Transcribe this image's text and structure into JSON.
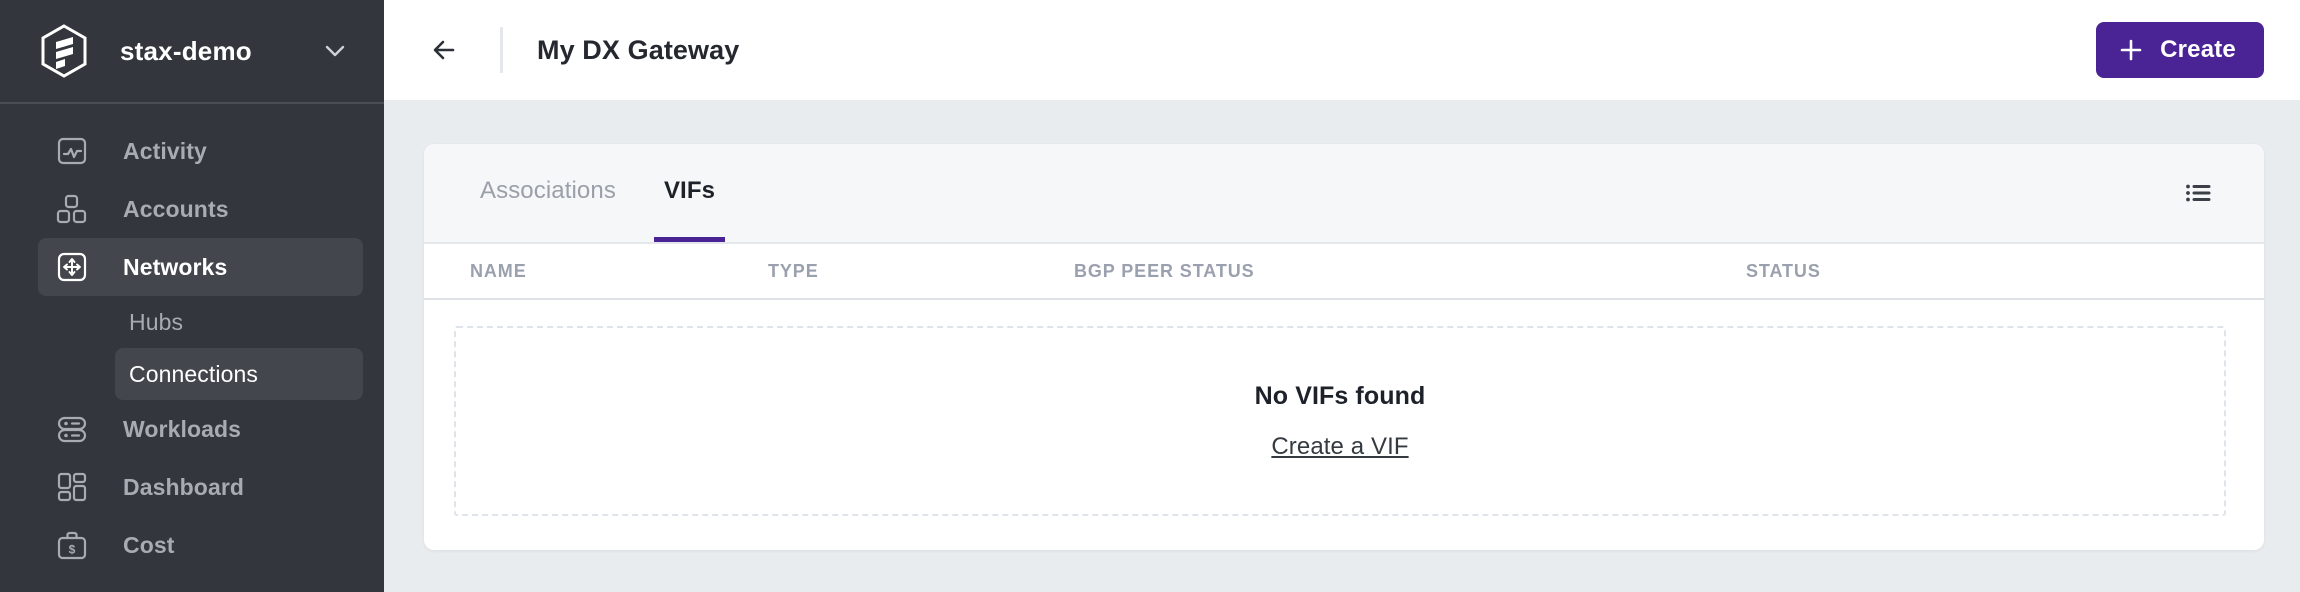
{
  "sidebar": {
    "org": {
      "name": "stax-demo",
      "logo_icon": "stax-hexagon-logo",
      "caret_icon": "chevron-down-icon"
    },
    "items": [
      {
        "label": "Activity",
        "icon": "activity-chart-icon",
        "active": false
      },
      {
        "label": "Accounts",
        "icon": "accounts-blocks-icon",
        "active": false
      },
      {
        "label": "Networks",
        "icon": "networks-move-icon",
        "active": true
      },
      {
        "label": "Workloads",
        "icon": "workloads-stack-icon",
        "active": false
      },
      {
        "label": "Dashboard",
        "icon": "dashboard-grid-icon",
        "active": false
      },
      {
        "label": "Cost",
        "icon": "cost-briefcase-icon",
        "active": false
      }
    ],
    "sub_items": [
      {
        "label": "Hubs",
        "active": false
      },
      {
        "label": "Connections",
        "active": true
      }
    ]
  },
  "topbar": {
    "back_icon": "arrow-left-icon",
    "title": "My DX Gateway",
    "create_label": "Create",
    "create_icon": "plus-icon",
    "create_color": "#4a2394"
  },
  "card": {
    "tabs": [
      {
        "label": "Associations",
        "active": false
      },
      {
        "label": "VIFs",
        "active": true
      }
    ],
    "list_view_icon": "list-view-icon",
    "table": {
      "columns": [
        "NAME",
        "TYPE",
        "BGP PEER STATUS",
        "STATUS"
      ],
      "rows": []
    },
    "empty_state": {
      "title": "No VIFs found",
      "link": "Create a VIF"
    }
  }
}
